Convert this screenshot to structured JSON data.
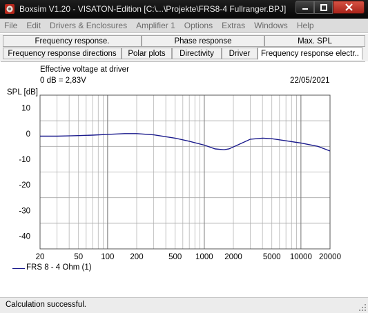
{
  "window": {
    "title": "Boxsim V1.20 - VISATON-Edition [C:\\...\\Projekte\\FRS8-4 Fullranger.BPJ]"
  },
  "titlebar_icons": [
    "app-icon",
    "minimize-icon",
    "maximize-icon",
    "close-icon"
  ],
  "menubar": {
    "items": [
      "File",
      "Edit",
      "Drivers & Enclosures",
      "Amplifier 1",
      "Options",
      "Extras",
      "Windows",
      "Help"
    ]
  },
  "tabs": {
    "row1": [
      "Frequency response.",
      "Phase response",
      "Max. SPL"
    ],
    "row2": [
      "Frequency response directions",
      "Polar plots",
      "Directivity",
      "Driver",
      "Frequency response electr.."
    ],
    "active": "Frequency response electr.."
  },
  "plot": {
    "subtitle": "Effective voltage at driver",
    "reference": "0 dB = 2,83V",
    "date": "22/05/2021",
    "legend_entry": "FRS 8 - 4 Ohm (1)"
  },
  "chart_data": {
    "type": "line",
    "title": "Effective voltage at driver",
    "xlabel": "",
    "ylabel": "SPL [dB]",
    "x_scale": "log",
    "xlim": [
      20,
      20000
    ],
    "ylim": [
      -45,
      15
    ],
    "y_ticks": [
      10,
      0,
      -10,
      -20,
      -30,
      -40
    ],
    "x_ticks": [
      20,
      50,
      100,
      200,
      500,
      1000,
      2000,
      5000,
      10000,
      20000
    ],
    "x_tick_labels": [
      "20",
      "50",
      "100",
      "200",
      "500",
      "1000",
      "2000",
      "5000",
      "10000",
      "20000"
    ],
    "grid": true,
    "legend": "bottom-left",
    "series": [
      {
        "name": "FRS 8 - 4 Ohm (1)",
        "color": "#1a1a8c",
        "x": [
          20,
          30,
          40,
          50,
          70,
          100,
          150,
          200,
          300,
          500,
          700,
          1000,
          1300,
          1600,
          1800,
          2200,
          3000,
          4000,
          5000,
          7000,
          10000,
          15000,
          20000
        ],
        "y": [
          -1.0,
          -1.0,
          -0.9,
          -0.8,
          -0.6,
          -0.3,
          0.0,
          0.0,
          -0.5,
          -1.8,
          -3.0,
          -4.5,
          -6.0,
          -6.3,
          -6.0,
          -4.5,
          -2.2,
          -1.8,
          -2.0,
          -2.8,
          -3.7,
          -5.0,
          -6.8
        ]
      }
    ]
  },
  "status": {
    "text": "Calculation successful."
  }
}
